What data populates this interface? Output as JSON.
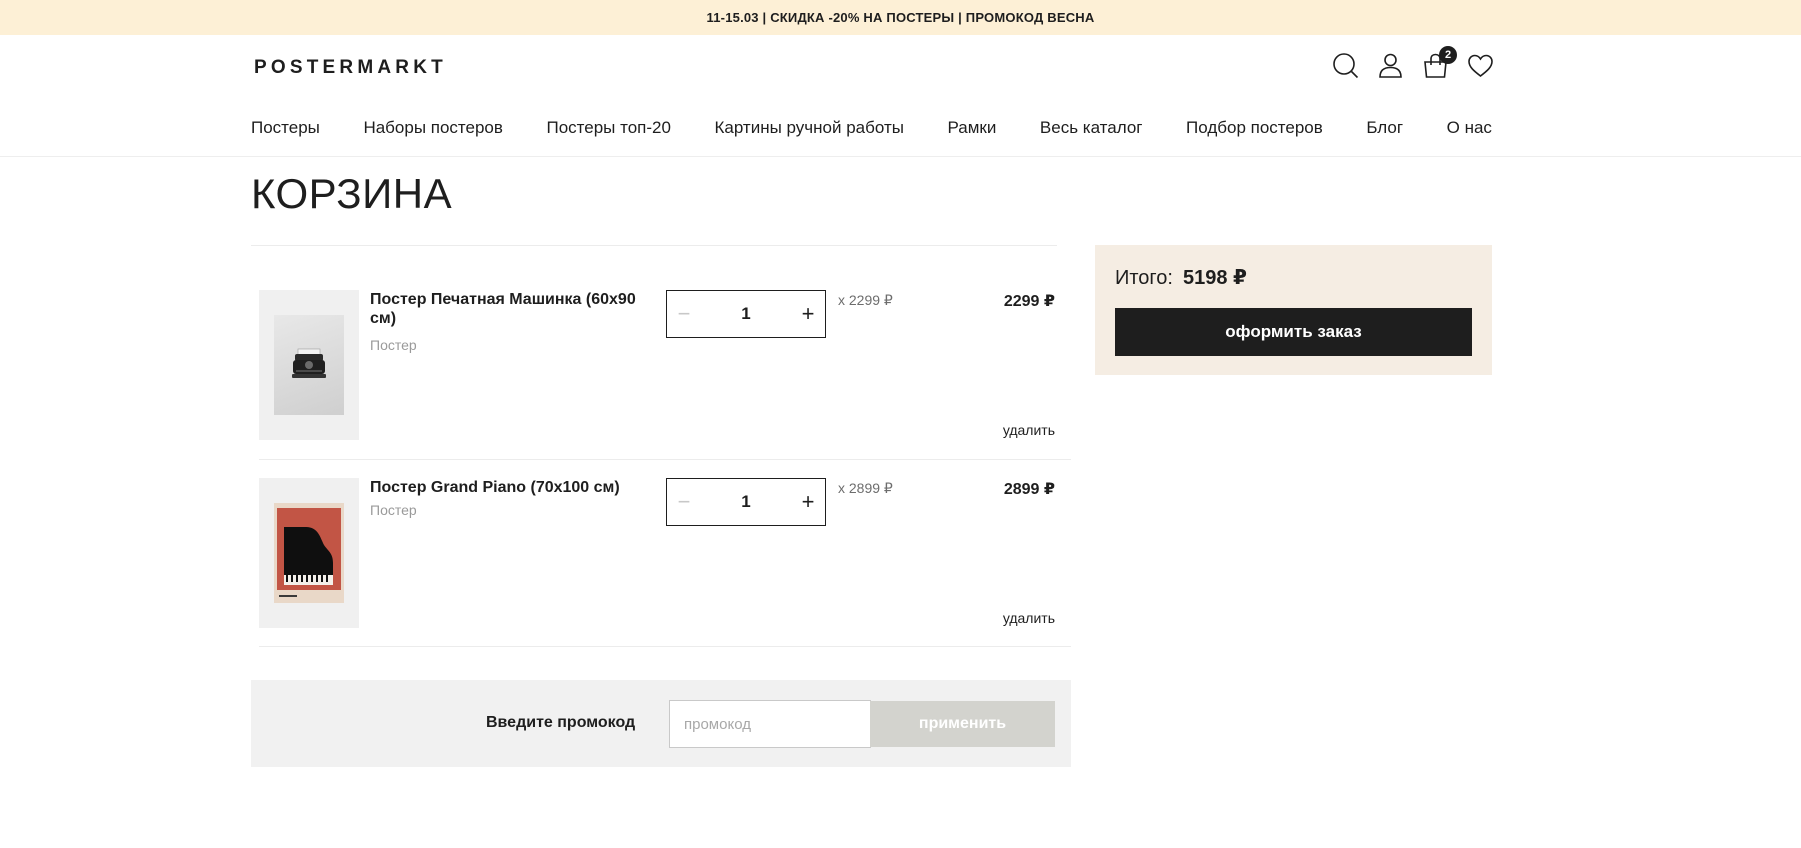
{
  "promo_bar": {
    "text": "11-15.03 | СКИДКА -20% НА ПОСТЕРЫ | ПРОМОКОД ВЕСНА"
  },
  "header": {
    "logo": "POSTERMARKT",
    "cart_count": "2",
    "icons": [
      "search-icon",
      "user-icon",
      "cart-icon",
      "heart-icon"
    ]
  },
  "nav": {
    "items": [
      {
        "label": "Постеры"
      },
      {
        "label": "Наборы постеров"
      },
      {
        "label": "Постеры топ-20"
      },
      {
        "label": "Картины ручной работы"
      },
      {
        "label": "Рамки"
      },
      {
        "label": "Весь каталог"
      },
      {
        "label": "Подбор постеров"
      },
      {
        "label": "Блог"
      },
      {
        "label": "О нас"
      }
    ]
  },
  "page": {
    "title": "КОРЗИНА"
  },
  "cart": {
    "items": [
      {
        "name": "Постер Печатная Машинка (60x90 см)",
        "type": "Постер",
        "quantity": "1",
        "minus": "−",
        "plus": "+",
        "unit_price": "x 2299 ₽",
        "total": "2299 ₽",
        "delete": "удалить"
      },
      {
        "name": "Постер Grand Piano (70x100 см)",
        "type": "Постер",
        "quantity": "1",
        "minus": "−",
        "plus": "+",
        "unit_price": "x 2899 ₽",
        "total": "2899 ₽",
        "delete": "удалить"
      }
    ]
  },
  "promo": {
    "label": "Введите промокод",
    "placeholder": "промокод",
    "apply": "применить"
  },
  "summary": {
    "total_label": "Итого:",
    "total_value": "5198 ₽",
    "checkout": "оформить заказ"
  },
  "colors": {
    "promo_bar_bg": "#fdf0d6",
    "summary_bg": "#f5ede3",
    "dark": "#1e1e1e",
    "apply_disabled": "#d3d3ce"
  }
}
